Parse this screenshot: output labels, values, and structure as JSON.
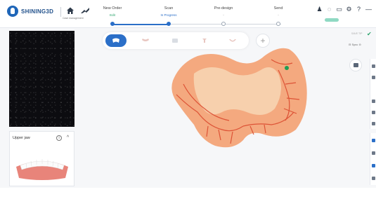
{
  "app": {
    "logo_text": "SHINING3D"
  },
  "nav": {
    "home_label": "Case management",
    "steps": [
      {
        "title": "New Order",
        "status": "Edit",
        "status_color": "#2aa36b",
        "active": true
      },
      {
        "title": "Scan",
        "status": "In Progress",
        "status_color": "#2b6fc8",
        "active": true
      },
      {
        "title": "Pre-design",
        "status": "-",
        "status_color": "#888888",
        "active": false
      },
      {
        "title": "Send",
        "status": "-",
        "status_color": "#888888",
        "active": false
      }
    ],
    "icons": [
      "user-icon",
      "settings-icon",
      "screen-icon",
      "gear-icon",
      "help-icon",
      "minimize-icon"
    ],
    "icon_glyphs": [
      "♟",
      "◌",
      "▭",
      "⚙",
      "?",
      "—"
    ]
  },
  "toolbar": {
    "items": [
      {
        "name": "upper-jaw-tool",
        "active": true
      },
      {
        "name": "lower-jaw-tool",
        "active": false
      },
      {
        "name": "bite-tool",
        "active": false
      },
      {
        "name": "implant-tool",
        "active": false
      },
      {
        "name": "denture-tool",
        "active": false
      }
    ],
    "add_label": "+"
  },
  "left_panel": {
    "jaw_card_title": "Upper jaw",
    "info_glyph": "i",
    "collapse_glyph": "^"
  },
  "right_panel": {
    "label": "SAVE TIP",
    "check_glyph": "✔",
    "toggle_text": "⊟ Sync   ⊝"
  },
  "colors": {
    "accent": "#2b6fc8",
    "scan_tissue": "#f2a47a",
    "scan_veins": "#d9452a",
    "marker": "#1f9d55"
  }
}
